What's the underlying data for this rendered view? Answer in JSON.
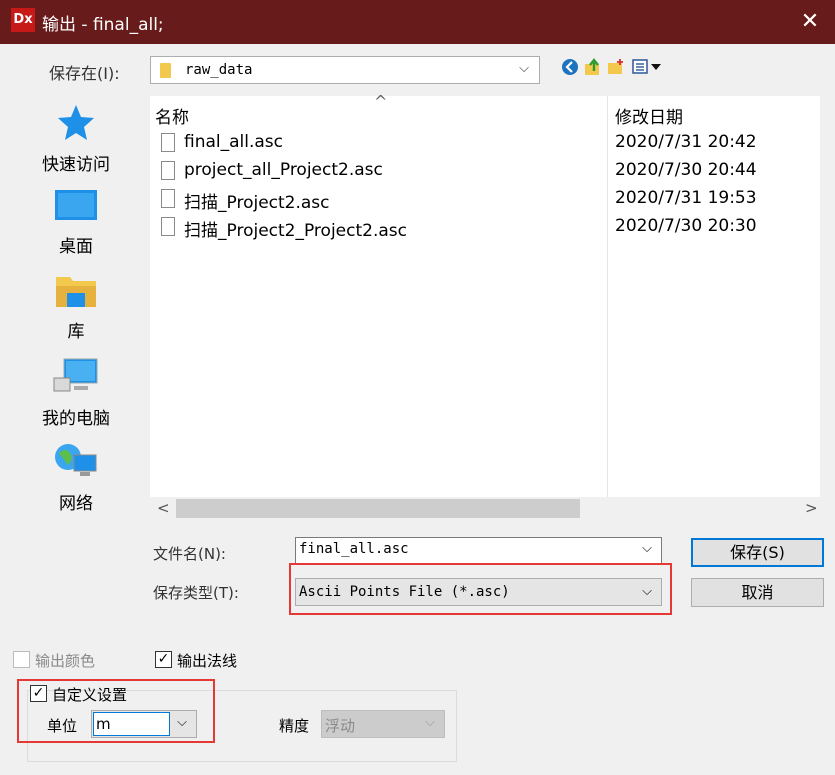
{
  "window": {
    "app_icon_text": "Dx",
    "title": "输出 - final_all;",
    "close_glyph": "✕"
  },
  "location": {
    "label": "保存在(I):",
    "folder": "raw_data",
    "arrow": "⌵"
  },
  "places": [
    {
      "label": "快速访问",
      "icon": "star-icon"
    },
    {
      "label": "桌面",
      "icon": "desktop-icon"
    },
    {
      "label": "库",
      "icon": "library-icon"
    },
    {
      "label": "我的电脑",
      "icon": "computer-icon"
    },
    {
      "label": "网络",
      "icon": "network-icon"
    }
  ],
  "columns": {
    "name": "名称",
    "date": "修改日期",
    "sort_arrow": "^"
  },
  "files": [
    {
      "name": "final_all.asc",
      "date": "2020/7/31 20:42"
    },
    {
      "name": "project_all_Project2.asc",
      "date": "2020/7/30 20:44"
    },
    {
      "name": "扫描_Project2.asc",
      "date": "2020/7/31 19:53"
    },
    {
      "name": "扫描_Project2_Project2.asc",
      "date": "2020/7/30 20:30"
    }
  ],
  "scroll": {
    "left": "<",
    "right": ">"
  },
  "filename": {
    "label": "文件名(N):",
    "value": "final_all.asc"
  },
  "filetype": {
    "label": "保存类型(T):",
    "value": "Ascii Points File (*.asc)"
  },
  "buttons": {
    "save": "保存(S)",
    "cancel": "取消"
  },
  "options": {
    "output_color": {
      "label": "输出颜色",
      "checked": false,
      "enabled": false
    },
    "output_normals": {
      "label": "输出法线",
      "checked": true
    },
    "custom": {
      "label": "自定义设置",
      "checked": true
    },
    "unit_label": "单位",
    "unit_value": "m",
    "precision_label": "精度",
    "precision_value": "浮动",
    "check_glyph": "✓"
  },
  "colors": {
    "titlebar": "#681b1b",
    "highlight": "#e53935",
    "accent": "#0078d7"
  }
}
